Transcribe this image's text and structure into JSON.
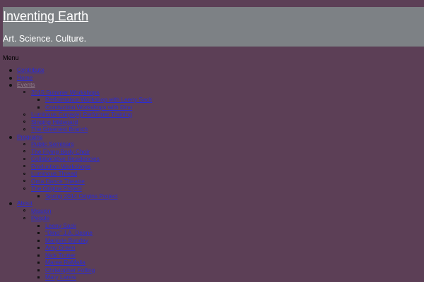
{
  "header": {
    "site_title": "Inventing Earth",
    "tagline": "Art. Science. Culture."
  },
  "menu_toggle": "Menu",
  "colors": {
    "background": "#5c3f56",
    "header_band": "#7d8185",
    "link": "#2b2bd6",
    "inactive_link": "#8e7d8a"
  },
  "nav": {
    "contribute": "Contribute",
    "home": "Home",
    "events": {
      "label": "Events",
      "workshops_2015": {
        "label": "2015 Summer Workshops",
        "children": [
          "Performance Workshop with Leeny Sack",
          "Conduction Workshops with Dino"
        ]
      },
      "luminous_training": "Luminous Corps(e) Performer Training",
      "singing_hildegard": "Singing Hildegard",
      "greenest_branch": "The Greenest Branch"
    },
    "programs": {
      "label": "Programs",
      "public_seminars": "Public Seminars",
      "flying_body": "The Flying Body Choir",
      "collab_residencies": "Collaborative Residencies",
      "production_workshops": "Production Workshops",
      "luminous_thread": "Luminous Thread",
      "oma_dance": "Oma Dance Theatre",
      "origins": {
        "label": "The Origins Project",
        "children": [
          "Spring 2014 Origins Project"
        ]
      }
    },
    "about": {
      "label": "About",
      "mission": "Mission",
      "people": {
        "label": "People",
        "children": [
          "Leeny Sack",
          "\"Dino\" J.A. Deane",
          "Marjorie Bunday",
          "Amy Green",
          "Nick Trotter",
          "Maree ReMalia",
          "Christopher Folling",
          "Mary Larew"
        ]
      }
    }
  }
}
